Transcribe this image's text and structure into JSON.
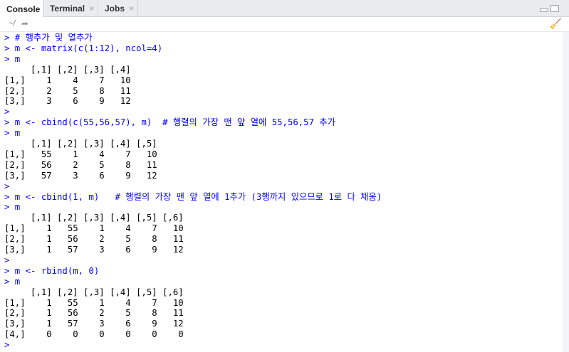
{
  "tabs": [
    {
      "label": "Console",
      "closable": false
    },
    {
      "label": "Terminal",
      "closable": true
    },
    {
      "label": "Jobs",
      "closable": true
    }
  ],
  "path": "~/",
  "lines": [
    {
      "type": "in",
      "text": "> # 행추가 및 열추가"
    },
    {
      "type": "in",
      "text": "> m <- matrix(c(1:12), ncol=4)"
    },
    {
      "type": "in",
      "text": "> m"
    },
    {
      "type": "out",
      "text": "     [,1] [,2] [,3] [,4]"
    },
    {
      "type": "out",
      "text": "[1,]    1    4    7   10"
    },
    {
      "type": "out",
      "text": "[2,]    2    5    8   11"
    },
    {
      "type": "out",
      "text": "[3,]    3    6    9   12"
    },
    {
      "type": "in",
      "text": ">"
    },
    {
      "type": "in",
      "text": "> m <- cbind(c(55,56,57), m)  # 행렬의 가장 맨 앞 열에 55,56,57 추가"
    },
    {
      "type": "in",
      "text": "> m"
    },
    {
      "type": "out",
      "text": "     [,1] [,2] [,3] [,4] [,5]"
    },
    {
      "type": "out",
      "text": "[1,]   55    1    4    7   10"
    },
    {
      "type": "out",
      "text": "[2,]   56    2    5    8   11"
    },
    {
      "type": "out",
      "text": "[3,]   57    3    6    9   12"
    },
    {
      "type": "in",
      "text": ">"
    },
    {
      "type": "in",
      "text": "> m <- cbind(1, m)   # 행렬의 가장 맨 앞 열에 1추가 (3행까지 있으므로 1로 다 채움)"
    },
    {
      "type": "in",
      "text": "> m"
    },
    {
      "type": "out",
      "text": "     [,1] [,2] [,3] [,4] [,5] [,6]"
    },
    {
      "type": "out",
      "text": "[1,]    1   55    1    4    7   10"
    },
    {
      "type": "out",
      "text": "[2,]    1   56    2    5    8   11"
    },
    {
      "type": "out",
      "text": "[3,]    1   57    3    6    9   12"
    },
    {
      "type": "in",
      "text": ">"
    },
    {
      "type": "in",
      "text": "> m <- rbind(m, 0)"
    },
    {
      "type": "in",
      "text": "> m"
    },
    {
      "type": "out",
      "text": "     [,1] [,2] [,3] [,4] [,5] [,6]"
    },
    {
      "type": "out",
      "text": "[1,]    1   55    1    4    7   10"
    },
    {
      "type": "out",
      "text": "[2,]    1   56    2    5    8   11"
    },
    {
      "type": "out",
      "text": "[3,]    1   57    3    6    9   12"
    },
    {
      "type": "out",
      "text": "[4,]    0    0    0    0    0    0"
    },
    {
      "type": "in",
      "text": ">"
    }
  ]
}
